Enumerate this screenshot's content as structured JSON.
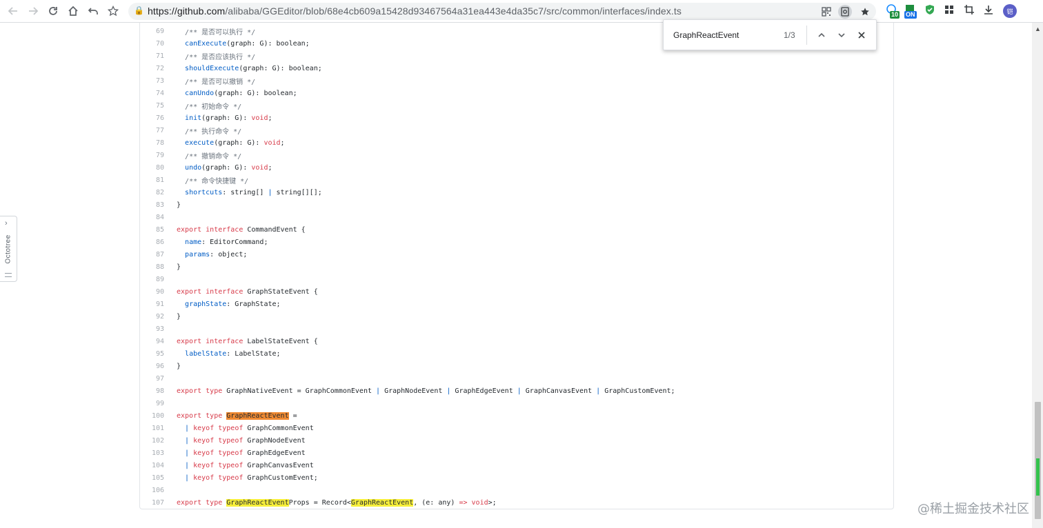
{
  "browser": {
    "url_host": "https://github.com",
    "url_path": "/alibaba/GGEditor/blob/68e4cb609a15428d93467564a31ea443e4da35c7/src/common/interfaces/index.ts",
    "extensions": [
      {
        "name": "extension-a",
        "badge": "10",
        "color": "#1a8cff",
        "badge_color": "#1e8e3e"
      },
      {
        "name": "extension-b",
        "badge": "ON",
        "color": "#1e8e3e",
        "badge_color": "#1a73e8"
      },
      {
        "name": "shield-extension",
        "badge": "",
        "color": "#34a853",
        "badge_color": ""
      }
    ],
    "avatar": "铠"
  },
  "find_bar": {
    "query": "GraphReactEvent",
    "count": "1/3"
  },
  "octotree": {
    "label": "Octotree"
  },
  "watermark": "@稀土掘金技术社区",
  "highlight_colors": {
    "match": "#f7ef3a",
    "active_match": "#f08a32"
  },
  "code_lines": [
    {
      "n": "69",
      "tokens": [
        [
          "  ",
          ""
        ],
        [
          "/** 是否可以执行 */",
          "c"
        ]
      ]
    },
    {
      "n": "70",
      "tokens": [
        [
          "  ",
          ""
        ],
        [
          "canExecute",
          "p"
        ],
        [
          "(graph: G): boolean;",
          ""
        ]
      ]
    },
    {
      "n": "71",
      "tokens": [
        [
          "  ",
          ""
        ],
        [
          "/** 是否应该执行 */",
          "c"
        ]
      ]
    },
    {
      "n": "72",
      "tokens": [
        [
          "  ",
          ""
        ],
        [
          "shouldExecute",
          "p"
        ],
        [
          "(graph: G): boolean;",
          ""
        ]
      ]
    },
    {
      "n": "73",
      "tokens": [
        [
          "  ",
          ""
        ],
        [
          "/** 是否可以撤销 */",
          "c"
        ]
      ]
    },
    {
      "n": "74",
      "tokens": [
        [
          "  ",
          ""
        ],
        [
          "canUndo",
          "p"
        ],
        [
          "(graph: G): boolean;",
          ""
        ]
      ]
    },
    {
      "n": "75",
      "tokens": [
        [
          "  ",
          ""
        ],
        [
          "/** 初始命令 */",
          "c"
        ]
      ]
    },
    {
      "n": "76",
      "tokens": [
        [
          "  ",
          ""
        ],
        [
          "init",
          "p"
        ],
        [
          "(graph: G): ",
          ""
        ],
        [
          "void",
          "k"
        ],
        [
          ";",
          ""
        ]
      ]
    },
    {
      "n": "77",
      "tokens": [
        [
          "  ",
          ""
        ],
        [
          "/** 执行命令 */",
          "c"
        ]
      ]
    },
    {
      "n": "78",
      "tokens": [
        [
          "  ",
          ""
        ],
        [
          "execute",
          "p"
        ],
        [
          "(graph: G): ",
          ""
        ],
        [
          "void",
          "k"
        ],
        [
          ";",
          ""
        ]
      ]
    },
    {
      "n": "79",
      "tokens": [
        [
          "  ",
          ""
        ],
        [
          "/** 撤销命令 */",
          "c"
        ]
      ]
    },
    {
      "n": "80",
      "tokens": [
        [
          "  ",
          ""
        ],
        [
          "undo",
          "p"
        ],
        [
          "(graph: G): ",
          ""
        ],
        [
          "void",
          "k"
        ],
        [
          ";",
          ""
        ]
      ]
    },
    {
      "n": "81",
      "tokens": [
        [
          "  ",
          ""
        ],
        [
          "/** 命令快捷键 */",
          "c"
        ]
      ]
    },
    {
      "n": "82",
      "tokens": [
        [
          "  ",
          ""
        ],
        [
          "shortcuts",
          "p"
        ],
        [
          ": string[] ",
          ""
        ],
        [
          "|",
          "p"
        ],
        [
          " string[][];",
          ""
        ]
      ]
    },
    {
      "n": "83",
      "tokens": [
        [
          "}",
          ""
        ]
      ]
    },
    {
      "n": "84",
      "tokens": []
    },
    {
      "n": "85",
      "tokens": [
        [
          "export",
          "k"
        ],
        [
          " ",
          ""
        ],
        [
          "interface",
          "k"
        ],
        [
          " CommandEvent {",
          ""
        ]
      ]
    },
    {
      "n": "86",
      "tokens": [
        [
          "  ",
          ""
        ],
        [
          "name",
          "p"
        ],
        [
          ": EditorCommand;",
          ""
        ]
      ]
    },
    {
      "n": "87",
      "tokens": [
        [
          "  ",
          ""
        ],
        [
          "params",
          "p"
        ],
        [
          ": object;",
          ""
        ]
      ]
    },
    {
      "n": "88",
      "tokens": [
        [
          "}",
          ""
        ]
      ]
    },
    {
      "n": "89",
      "tokens": []
    },
    {
      "n": "90",
      "tokens": [
        [
          "export",
          "k"
        ],
        [
          " ",
          ""
        ],
        [
          "interface",
          "k"
        ],
        [
          " GraphStateEvent {",
          ""
        ]
      ]
    },
    {
      "n": "91",
      "tokens": [
        [
          "  ",
          ""
        ],
        [
          "graphState",
          "p"
        ],
        [
          ": GraphState;",
          ""
        ]
      ]
    },
    {
      "n": "92",
      "tokens": [
        [
          "}",
          ""
        ]
      ]
    },
    {
      "n": "93",
      "tokens": []
    },
    {
      "n": "94",
      "tokens": [
        [
          "export",
          "k"
        ],
        [
          " ",
          ""
        ],
        [
          "interface",
          "k"
        ],
        [
          " LabelStateEvent {",
          ""
        ]
      ]
    },
    {
      "n": "95",
      "tokens": [
        [
          "  ",
          ""
        ],
        [
          "labelState",
          "p"
        ],
        [
          ": LabelState;",
          ""
        ]
      ]
    },
    {
      "n": "96",
      "tokens": [
        [
          "}",
          ""
        ]
      ]
    },
    {
      "n": "97",
      "tokens": []
    },
    {
      "n": "98",
      "tokens": [
        [
          "export",
          "k"
        ],
        [
          " ",
          ""
        ],
        [
          "type",
          "k"
        ],
        [
          " GraphNativeEvent = GraphCommonEvent ",
          ""
        ],
        [
          "|",
          "p"
        ],
        [
          " GraphNodeEvent ",
          ""
        ],
        [
          "|",
          "p"
        ],
        [
          " GraphEdgeEvent ",
          ""
        ],
        [
          "|",
          "p"
        ],
        [
          " GraphCanvasEvent ",
          ""
        ],
        [
          "|",
          "p"
        ],
        [
          " GraphCustomEvent;",
          ""
        ]
      ]
    },
    {
      "n": "99",
      "tokens": []
    },
    {
      "n": "100",
      "tokens": [
        [
          "export",
          "k"
        ],
        [
          " ",
          ""
        ],
        [
          "type",
          "k"
        ],
        [
          " ",
          ""
        ],
        [
          "GraphReactEvent",
          "hla"
        ],
        [
          " =",
          ""
        ]
      ]
    },
    {
      "n": "101",
      "tokens": [
        [
          "  ",
          ""
        ],
        [
          "|",
          "p"
        ],
        [
          " ",
          ""
        ],
        [
          "keyof",
          "k"
        ],
        [
          " ",
          ""
        ],
        [
          "typeof",
          "k"
        ],
        [
          " GraphCommonEvent",
          ""
        ]
      ]
    },
    {
      "n": "102",
      "tokens": [
        [
          "  ",
          ""
        ],
        [
          "|",
          "p"
        ],
        [
          " ",
          ""
        ],
        [
          "keyof",
          "k"
        ],
        [
          " ",
          ""
        ],
        [
          "typeof",
          "k"
        ],
        [
          " GraphNodeEvent",
          ""
        ]
      ]
    },
    {
      "n": "103",
      "tokens": [
        [
          "  ",
          ""
        ],
        [
          "|",
          "p"
        ],
        [
          " ",
          ""
        ],
        [
          "keyof",
          "k"
        ],
        [
          " ",
          ""
        ],
        [
          "typeof",
          "k"
        ],
        [
          " GraphEdgeEvent",
          ""
        ]
      ]
    },
    {
      "n": "104",
      "tokens": [
        [
          "  ",
          ""
        ],
        [
          "|",
          "p"
        ],
        [
          " ",
          ""
        ],
        [
          "keyof",
          "k"
        ],
        [
          " ",
          ""
        ],
        [
          "typeof",
          "k"
        ],
        [
          " GraphCanvasEvent",
          ""
        ]
      ]
    },
    {
      "n": "105",
      "tokens": [
        [
          "  ",
          ""
        ],
        [
          "|",
          "p"
        ],
        [
          " ",
          ""
        ],
        [
          "keyof",
          "k"
        ],
        [
          " ",
          ""
        ],
        [
          "typeof",
          "k"
        ],
        [
          " GraphCustomEvent;",
          ""
        ]
      ]
    },
    {
      "n": "106",
      "tokens": []
    },
    {
      "n": "107",
      "tokens": [
        [
          "export",
          "k"
        ],
        [
          " ",
          ""
        ],
        [
          "type",
          "k"
        ],
        [
          " ",
          ""
        ],
        [
          "GraphReactEvent",
          "hl"
        ],
        [
          "Props = Record<",
          ""
        ],
        [
          "GraphReactEvent",
          "hl"
        ],
        [
          ", (e: any) ",
          ""
        ],
        [
          "=>",
          "k"
        ],
        [
          " ",
          ""
        ],
        [
          "void",
          "k"
        ],
        [
          ">;",
          ""
        ]
      ]
    }
  ]
}
